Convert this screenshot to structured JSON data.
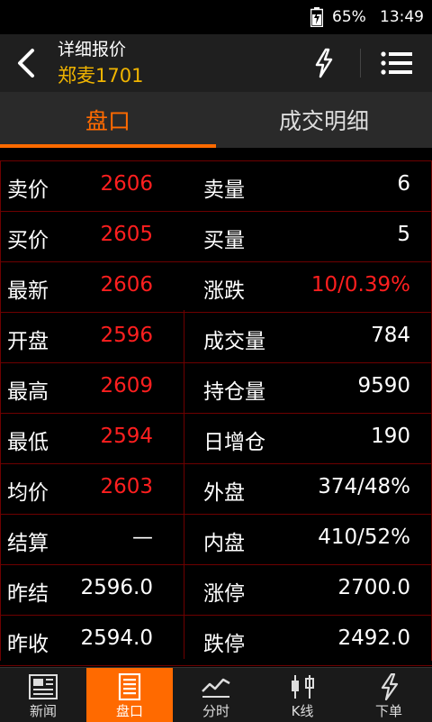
{
  "status_bar": {
    "battery": "65%",
    "time": "13:49"
  },
  "header": {
    "title": "详细报价",
    "instrument": "郑麦1701"
  },
  "tabs": [
    {
      "label": "盘口",
      "active": true
    },
    {
      "label": "成交明细",
      "active": false
    }
  ],
  "rows": [
    {
      "label": "卖价",
      "value": "2606",
      "label2": "卖量",
      "value2": "6"
    },
    {
      "label": "买价",
      "value": "2605",
      "label2": "买量",
      "value2": "5"
    },
    {
      "label": "最新",
      "value": "2606",
      "label2": "涨跌",
      "value2": "10/0.39%"
    },
    {
      "label": "开盘",
      "value": "2596",
      "label2": "成交量",
      "value2": "784"
    },
    {
      "label": "最高",
      "value": "2609",
      "label2": "持仓量",
      "value2": "9590"
    },
    {
      "label": "最低",
      "value": "2594",
      "label2": "日增仓",
      "value2": "190"
    },
    {
      "label": "均价",
      "value": "2603",
      "label2": "外盘",
      "value2": "374/48%"
    },
    {
      "label": "结算",
      "value": "—",
      "label2": "内盘",
      "value2": "410/52%"
    },
    {
      "label": "昨结",
      "value": "2596.0",
      "label2": "涨停",
      "value2": "2700.0"
    },
    {
      "label": "昨收",
      "value": "2594.0",
      "label2": "跌停",
      "value2": "2492.0"
    }
  ],
  "bottom_nav": [
    {
      "label": "新闻",
      "icon": "news-icon",
      "active": false
    },
    {
      "label": "盘口",
      "icon": "orderbook-icon",
      "active": true
    },
    {
      "label": "分时",
      "icon": "timeshare-chart-icon",
      "active": false
    },
    {
      "label": "K线",
      "icon": "candlestick-icon",
      "active": false
    },
    {
      "label": "下单",
      "icon": "flash-order-icon",
      "active": false
    }
  ],
  "colors": {
    "accent": "#ff6a00",
    "price_red": "#ff1f1f",
    "instrument_yellow": "#f0b400",
    "grid": "#6e0000"
  }
}
